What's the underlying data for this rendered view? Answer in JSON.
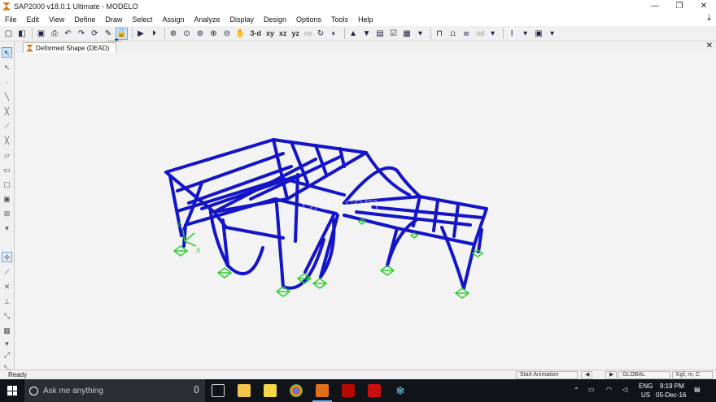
{
  "window": {
    "title": "SAP2000 v18.0.1 Ultimate  - MODELO",
    "min": "—",
    "restore": "❐",
    "close": "✕"
  },
  "menu": [
    "File",
    "Edit",
    "View",
    "Define",
    "Draw",
    "Select",
    "Assign",
    "Analyze",
    "Display",
    "Design",
    "Options",
    "Tools",
    "Help"
  ],
  "toolbar": {
    "view_3d": "3-d",
    "view_xy": "xy",
    "view_xz": "xz",
    "view_yz": "yz",
    "view_nv": "nv",
    "view_nd": "nd"
  },
  "tab": {
    "label": "Deformed Shape (DEAD)",
    "close": "✕"
  },
  "viewport": {
    "watermark": "CiUT.com",
    "axis_x": "X",
    "axis_z": "Z"
  },
  "status": {
    "ready": "Ready",
    "start_animation": "Start Animation",
    "coord_system": "GLOBAL",
    "units": "Kgf, m, C"
  },
  "taskbar": {
    "search_placeholder": "Ask me anything",
    "lang": "ENG",
    "region": "US",
    "time": "9:19 PM",
    "date": "05-Dec-16"
  },
  "colors": {
    "frame": "#1414c8",
    "supports": "#2fcf2f",
    "app_accent": "#e0701a",
    "taskbar": "#101418"
  }
}
